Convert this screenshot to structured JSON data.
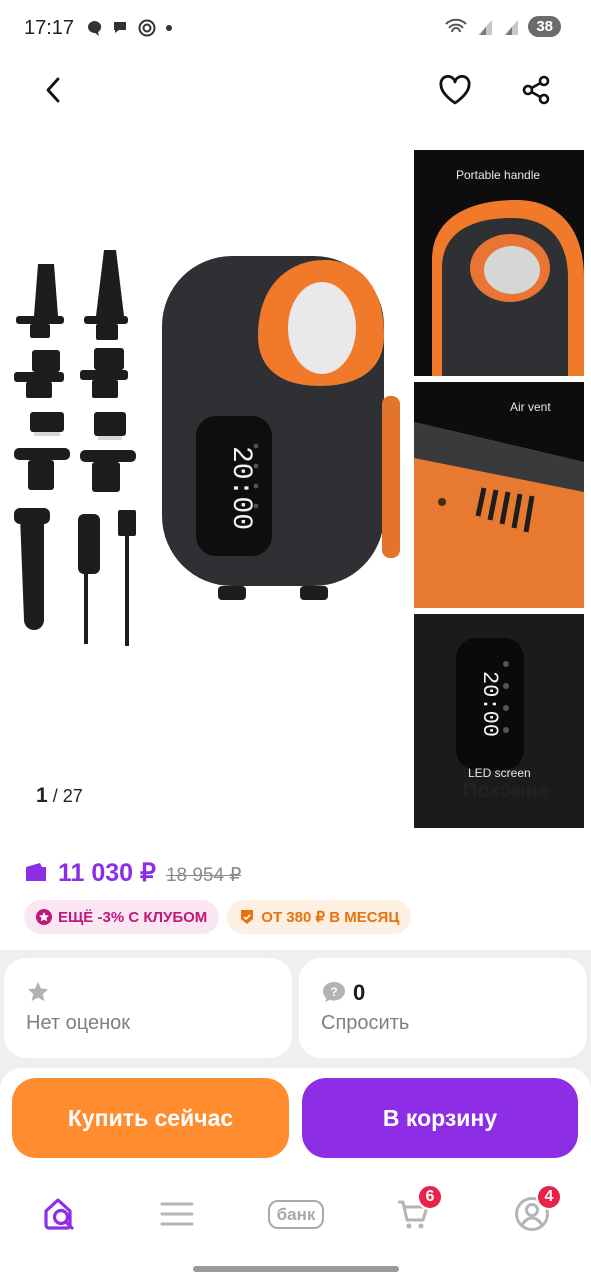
{
  "status_bar": {
    "time": "17:17",
    "battery": "38",
    "icons_left": [
      "chat-icon",
      "chat-bubbles-icon",
      "target-icon",
      "dot-icon"
    ],
    "icons_right": [
      "wifi-icon",
      "signal-icon",
      "signal-icon"
    ]
  },
  "top_nav": {
    "back_icon": "chevron-left-icon",
    "favorite_icon": "heart-icon",
    "share_icon": "share-icon"
  },
  "gallery": {
    "current": "1",
    "total": "/ 27",
    "similar_label": "Похожие",
    "display_reading": "20:00",
    "thumbnails": [
      {
        "label": "Portable handle"
      },
      {
        "label": "Air vent"
      },
      {
        "label": "LED screen",
        "display": "20:00"
      }
    ]
  },
  "price": {
    "current": "11 030 ₽",
    "old": "18 954 ₽",
    "wallet_icon": "wallet-icon",
    "club_chip": "ЕЩЁ -3% С КЛУБОМ",
    "split_chip": "ОТ 380 ₽ В МЕСЯЦ"
  },
  "info": {
    "rating_label": "Нет оценок",
    "rating_icon": "star-icon",
    "questions_count": "0",
    "ask_label": "Спросить",
    "ask_icon": "question-bubble-icon"
  },
  "actions": {
    "buy_now": "Купить сейчас",
    "add_to_cart": "В корзину"
  },
  "bottom_nav": {
    "tabs": [
      {
        "icon": "search-home-icon",
        "active": true
      },
      {
        "icon": "menu-icon"
      },
      {
        "icon": "bank-icon",
        "label": "банк"
      },
      {
        "icon": "cart-icon",
        "badge": "6"
      },
      {
        "icon": "profile-icon",
        "badge": "4"
      }
    ]
  },
  "colors": {
    "purple": "#8d2ee6",
    "orange": "#ff8c2e",
    "badge_red": "#e8234a",
    "club_pink": "#c1177b",
    "split_orange": "#e8720c"
  }
}
